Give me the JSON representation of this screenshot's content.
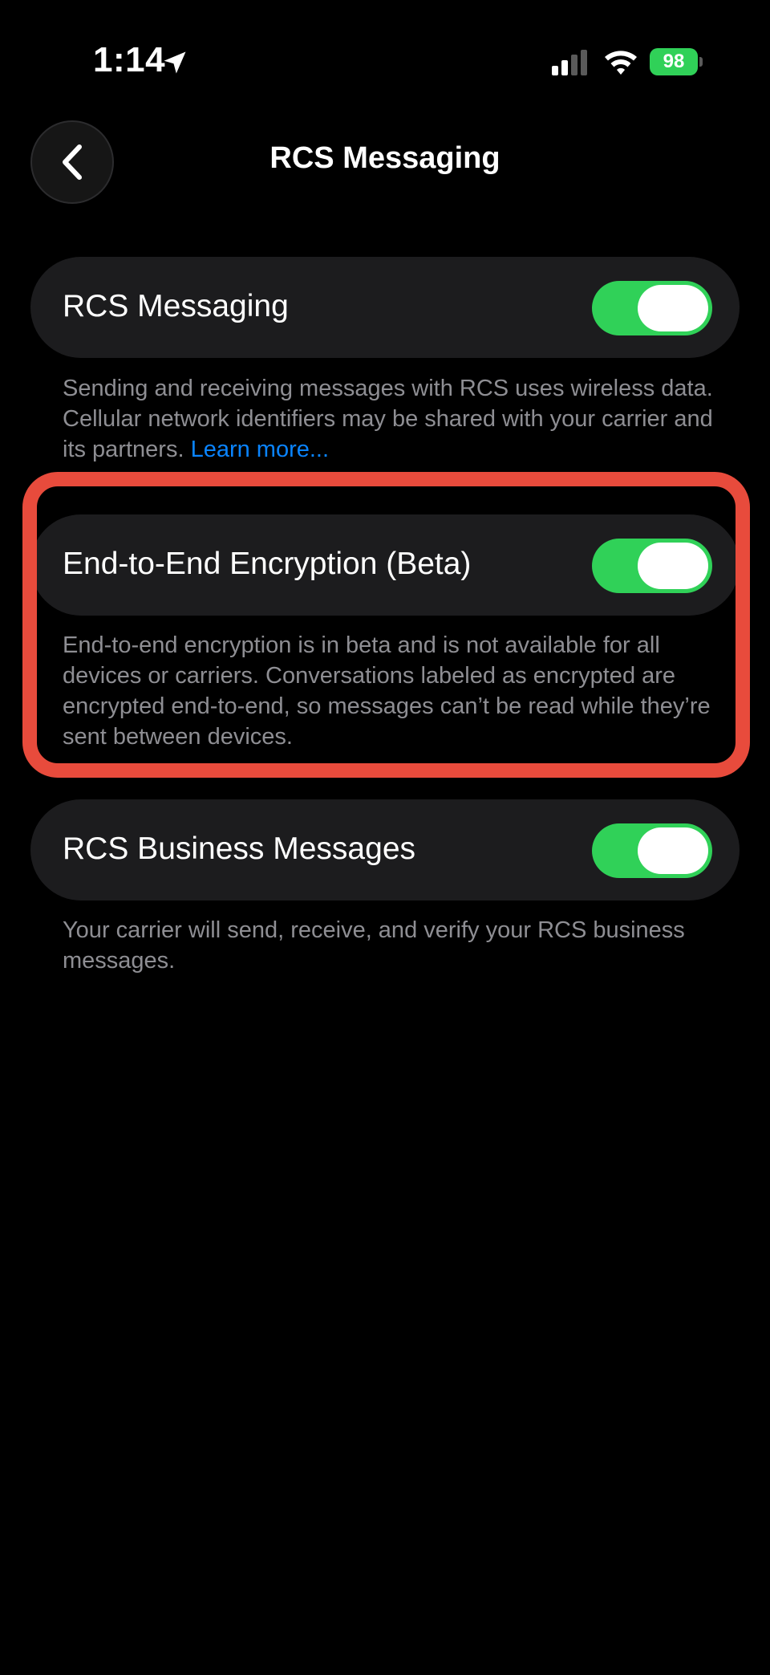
{
  "status_bar": {
    "time": "1:14",
    "battery": "98"
  },
  "nav": {
    "title": "RCS Messaging"
  },
  "settings": {
    "rcs_messaging": {
      "label": "RCS Messaging",
      "enabled": true,
      "footer": "Sending and receiving messages with RCS uses wireless data. Cellular network identifiers may be shared with your carrier and its partners.",
      "link": "Learn more..."
    },
    "e2e_encryption": {
      "label": "End-to-End Encryption (Beta)",
      "enabled": true,
      "footer": "End-to-end encryption is in beta and is not available for all devices or carriers. Conversations labeled as encrypted are encrypted end-to-end, so messages can’t be read while they’re sent between devices."
    },
    "rcs_business": {
      "label": "RCS Business Messages",
      "enabled": true,
      "footer": "Your carrier will send, receive, and verify your RCS business messages."
    }
  },
  "colors": {
    "toggle_on": "#30d158",
    "link": "#0a84ff",
    "highlight": "#e84b3c",
    "card_bg": "#1c1c1e"
  }
}
